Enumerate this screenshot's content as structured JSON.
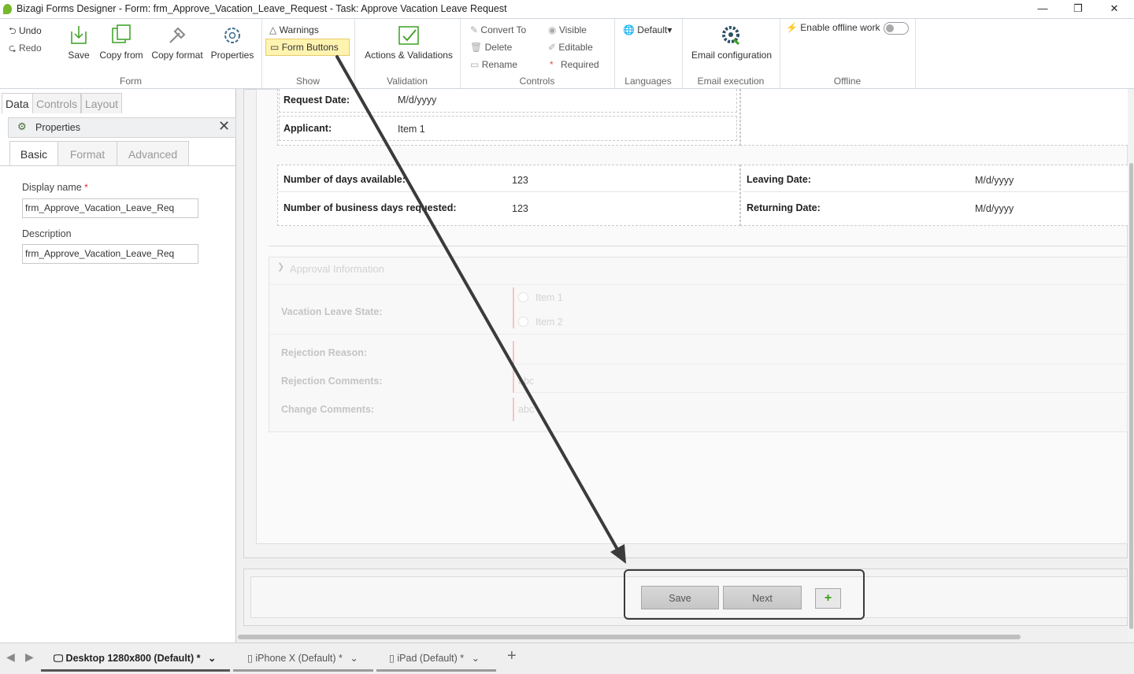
{
  "window": {
    "title": "Bizagi Forms Designer  - Form: frm_Approve_Vacation_Leave_Request - Task:  Approve Vacation Leave Request",
    "minimize": "—",
    "restore": "❐",
    "close": "✕"
  },
  "ribbon": {
    "form_group": {
      "undo": "Undo",
      "redo": "Redo",
      "save": "Save",
      "copy_from": "Copy from",
      "copy_format": "Copy format",
      "properties": "Properties",
      "label": "Form"
    },
    "show_group": {
      "warnings": "Warnings",
      "form_buttons": "Form Buttons",
      "label": "Show"
    },
    "validation_group": {
      "actions": "Actions & Validations",
      "label": "Validation"
    },
    "controls_group": {
      "convert_to": "Convert To",
      "delete": "Delete",
      "rename": "Rename",
      "visible": "Visible",
      "editable": "Editable",
      "required": "Required",
      "label": "Controls"
    },
    "languages_group": {
      "default": "Default▾",
      "label": "Languages"
    },
    "email_group": {
      "config": "Email configuration",
      "label": "Email execution"
    },
    "offline_group": {
      "enable": "Enable offline work",
      "label": "Offline"
    }
  },
  "left_panel": {
    "tabs": [
      "Data",
      "Controls",
      "Layout"
    ],
    "properties_title": "Properties",
    "prop_tabs": [
      "Basic",
      "Format",
      "Advanced"
    ],
    "display_name_label": "Display name",
    "required_mark": "*",
    "display_name_value": "frm_Approve_Vacation_Leave_Req",
    "description_label": "Description",
    "description_value": "frm_Approve_Vacation_Leave_Req"
  },
  "form": {
    "request_date_label": "Request Date:",
    "request_date_value": "M/d/yyyy",
    "applicant_label": "Applicant:",
    "applicant_value": "Item 1",
    "days_available_label": "Number of days available:",
    "days_available_value": "123",
    "business_days_label": "Number of business days requested:",
    "business_days_value": "123",
    "leaving_date_label": "Leaving Date:",
    "leaving_date_value": "M/d/yyyy",
    "returning_date_label": "Returning Date:",
    "returning_date_value": "M/d/yyyy",
    "approval_header": "Approval Information",
    "leave_state_label": "Vacation Leave State:",
    "leave_option1": "Item 1",
    "leave_option2": "Item 2",
    "rejection_reason_label": "Rejection Reason:",
    "rejection_comments_label": "Rejection Comments:",
    "rejection_comments_value": "abc",
    "change_comments_label": "Change Comments:",
    "change_comments_value": "abc"
  },
  "form_buttons": {
    "save": "Save",
    "next": "Next",
    "add": "+"
  },
  "bottom_tabs": [
    {
      "label": "Desktop 1280x800 (Default)",
      "modified": "*"
    },
    {
      "label": "iPhone X (Default)",
      "modified": "*"
    },
    {
      "label": "iPad (Default)",
      "modified": "*"
    }
  ],
  "colors": {
    "accent": "#76b82a",
    "highlight": "#fff3b0",
    "arrow": "#3b3b3b"
  },
  "icons": [
    "app-logo-icon",
    "undo-icon",
    "redo-icon",
    "save-icon",
    "copy-from-icon",
    "copy-format-icon",
    "properties-icon",
    "warning-icon",
    "form-buttons-icon",
    "actions-validations-icon",
    "convert-icon",
    "delete-icon",
    "rename-icon",
    "visible-icon",
    "editable-icon",
    "required-icon",
    "globe-icon",
    "email-config-icon",
    "offline-icon",
    "gear-icon",
    "close-icon",
    "chevron-down-icon",
    "plus-icon",
    "desktop-icon",
    "phone-icon",
    "tablet-icon"
  ]
}
